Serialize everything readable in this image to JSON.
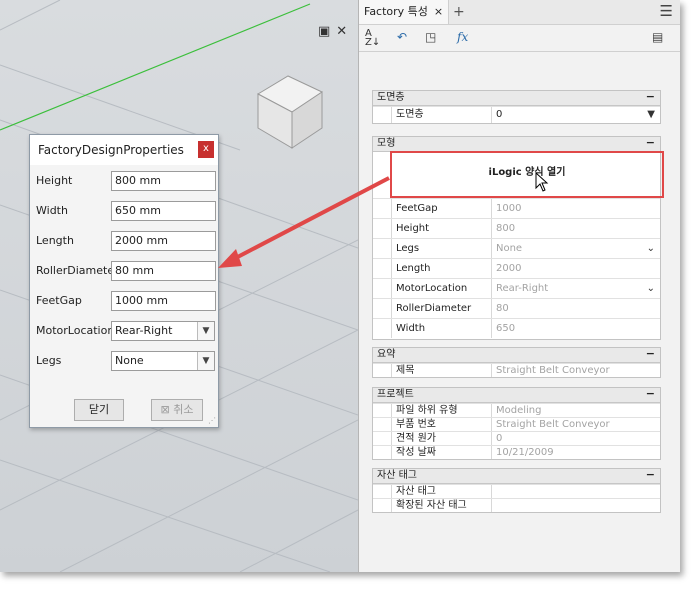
{
  "dialog": {
    "title": "FactoryDesignProperties",
    "close_icon": "close-icon",
    "fields": [
      {
        "label": "Height",
        "value": "800 mm",
        "type": "text"
      },
      {
        "label": "Width",
        "value": "650 mm",
        "type": "text"
      },
      {
        "label": "Length",
        "value": "2000 mm",
        "type": "text"
      },
      {
        "label": "RollerDiameter",
        "value": "80 mm",
        "type": "text"
      },
      {
        "label": "FeetGap",
        "value": "1000 mm",
        "type": "text"
      },
      {
        "label": "MotorLocation",
        "value": "Rear-Right",
        "type": "select"
      },
      {
        "label": "Legs",
        "value": "None",
        "type": "select"
      }
    ],
    "ok_label": "닫기",
    "cancel_label": "취소"
  },
  "panel": {
    "tab_title": "Factory 특성",
    "tab_close": "×",
    "tab_add": "+",
    "menu_icon": "hamburger-icon",
    "toolbar": [
      "sort-az-icon",
      "undo-icon",
      "new-rule-icon",
      "fx-icon",
      "settings-icon"
    ],
    "sections": {
      "layer": {
        "header": "도면층",
        "collapse": "−",
        "rows": [
          {
            "key": "도면층",
            "value": "0"
          }
        ]
      },
      "model": {
        "header": "모형",
        "collapse": "−",
        "ilogic_button": "iLogic 양식 열기",
        "rows": [
          {
            "key": "FeetGap",
            "value": "1000"
          },
          {
            "key": "Height",
            "value": "800"
          },
          {
            "key": "Legs",
            "value": "None"
          },
          {
            "key": "Length",
            "value": "2000"
          },
          {
            "key": "MotorLocation",
            "value": "Rear-Right"
          },
          {
            "key": "RollerDiameter",
            "value": "80"
          },
          {
            "key": "Width",
            "value": "650"
          }
        ]
      },
      "summary": {
        "header": "요약",
        "collapse": "−",
        "rows": [
          {
            "key": "제목",
            "value": "Straight Belt Conveyor"
          }
        ]
      },
      "project": {
        "header": "프로젝트",
        "collapse": "−",
        "rows": [
          {
            "key": "파일 하위 유형",
            "value": "Modeling"
          },
          {
            "key": "부품 번호",
            "value": "Straight Belt Conveyor"
          },
          {
            "key": "견적 원가",
            "value": "0"
          },
          {
            "key": "작성 날짜",
            "value": "10/21/2009"
          }
        ]
      },
      "asset": {
        "header": "자산 태그",
        "collapse": "−",
        "rows": [
          {
            "key": "자산 태그",
            "value": ""
          },
          {
            "key": "확장된 자산 태그",
            "value": ""
          }
        ]
      }
    }
  },
  "colors": {
    "annotation": "#e04848",
    "close_button": "#c7302f",
    "link_blue": "#2a6aa8"
  }
}
